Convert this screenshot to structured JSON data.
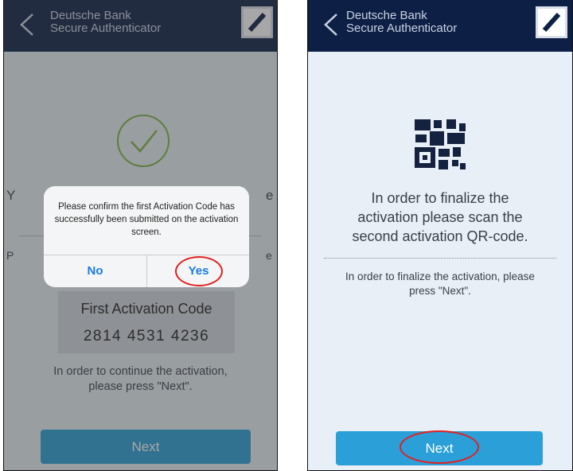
{
  "app": {
    "title_line1": "Deutsche Bank",
    "title_line2": "Secure Authenticator"
  },
  "left": {
    "dialog": {
      "message": "Please confirm the first Activation Code has successfully been submitted on the activation screen.",
      "no_label": "No",
      "yes_label": "Yes"
    },
    "partial_left_1": "Y",
    "partial_right_1": "e",
    "partial_left_2": "P",
    "partial_right_2": "e",
    "code_label": "First Activation Code",
    "code_value": "2814  4531  4236",
    "instruction": "In order to continue the activation, please press \"Next\".",
    "next_label": "Next"
  },
  "right": {
    "headline": "In order to finalize the activation please scan the second activation QR-code.",
    "instruction": "In order to finalize the activation, please press \"Next\".",
    "next_label": "Next"
  },
  "colors": {
    "header": "#0e1f46",
    "accent": "#2a9fd8",
    "dialog_button": "#1a7ae3",
    "success_check": "#7fb342",
    "highlight": "#e02020"
  },
  "icons": [
    "back-chevron-icon",
    "deutsche-bank-logo",
    "checkmark-circle-icon",
    "qr-code-icon"
  ]
}
